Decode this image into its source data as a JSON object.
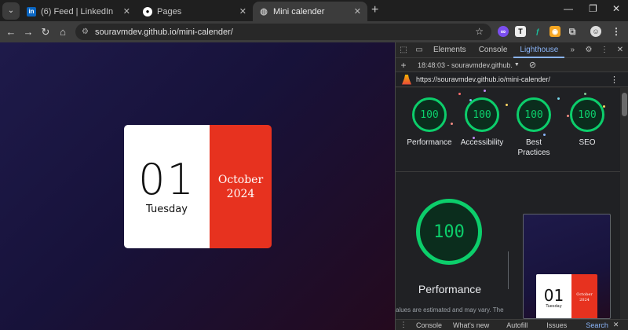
{
  "tabs": [
    {
      "title": "(6) Feed | LinkedIn",
      "favicon": "linkedin-icon",
      "active": false
    },
    {
      "title": "Pages",
      "favicon": "github-icon",
      "active": false
    },
    {
      "title": "Mini calender",
      "favicon": "globe-icon",
      "active": true
    }
  ],
  "toolbar": {
    "url": "souravmdev.github.io/mini-calender/"
  },
  "calendar": {
    "day": "01",
    "weekday": "Tuesday",
    "month": "October",
    "year": "2024",
    "accent": "#e7321f"
  },
  "devtools": {
    "tabs": [
      "Elements",
      "Console",
      "Lighthouse"
    ],
    "selected_tab": "Lighthouse",
    "report_time": "18:48:03 - souravmdev.github.",
    "report_url": "https://souravmdev.github.io/mini-calender/",
    "scores": [
      {
        "label": "Performance",
        "value": "100"
      },
      {
        "label": "Accessibility",
        "value": "100"
      },
      {
        "label": "Best Practices",
        "value": "100"
      },
      {
        "label": "SEO",
        "value": "100"
      }
    ],
    "main_score": {
      "label": "Performance",
      "value": "100"
    },
    "note": "alues are estimated and may vary. The",
    "thumbnail": {
      "day": "01",
      "weekday": "Tuesday",
      "month": "October",
      "year": "2024"
    },
    "drawer": [
      "Console",
      "What's new",
      "Autofill",
      "Issues",
      "Search"
    ]
  }
}
